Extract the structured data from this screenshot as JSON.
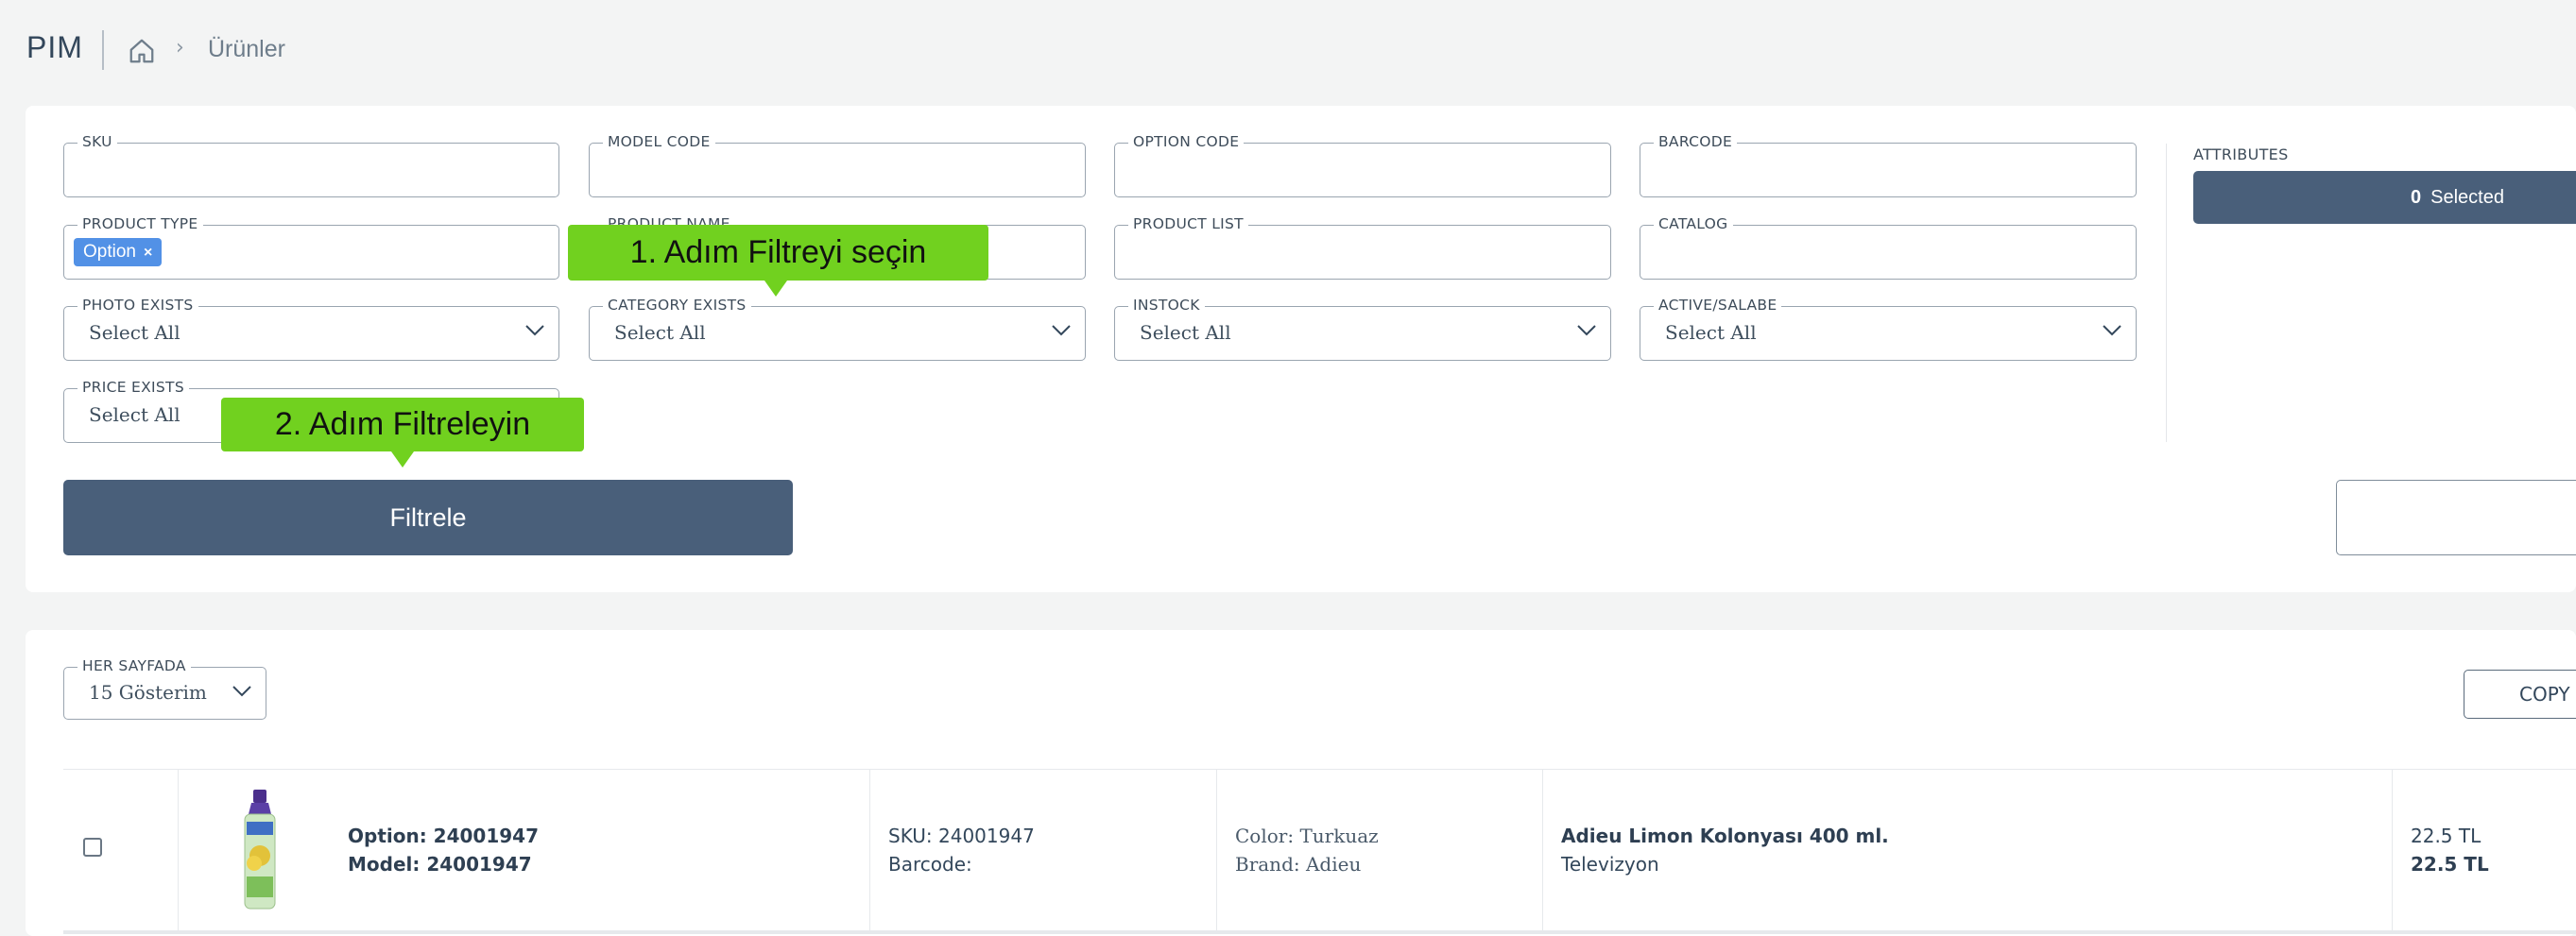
{
  "header": {
    "brand": "PIM",
    "breadcrumb": "Ürünler"
  },
  "filters": {
    "sku": {
      "label": "SKU",
      "value": ""
    },
    "model_code": {
      "label": "MODEL CODE",
      "value": ""
    },
    "option_code": {
      "label": "OPTION CODE",
      "value": ""
    },
    "barcode": {
      "label": "BARCODE",
      "value": ""
    },
    "product_type": {
      "label": "PRODUCT TYPE",
      "tag": "Option",
      "tag_remove": "×"
    },
    "product_name": {
      "label": "PRODUCT NAME",
      "value": ""
    },
    "product_list": {
      "label": "PRODUCT LIST",
      "value": ""
    },
    "catalog": {
      "label": "CATALOG",
      "value": ""
    },
    "photo_exists": {
      "label": "PHOTO EXISTS",
      "value": "Select All"
    },
    "category_exists": {
      "label": "CATEGORY EXISTS",
      "value": "Select All"
    },
    "instock": {
      "label": "INSTOCK",
      "value": "Select All"
    },
    "active_salable": {
      "label": "ACTIVE/SALABE",
      "value": "Select All"
    },
    "price_exists": {
      "label": "PRICE EXISTS",
      "value": "Select All"
    },
    "filter_button": "Filtrele"
  },
  "attributes": {
    "label": "ATTRIBUTES",
    "count": "0",
    "selected_text": "Selected"
  },
  "tooltips": {
    "step1": "1. Adım Filtreyi seçin",
    "step2": "2. Adım Filtreleyin"
  },
  "list": {
    "per_page_label": "HER SAYFADA",
    "per_page_value": "15 Gösterim",
    "copy_button": "COPY",
    "rows": [
      {
        "option": "Option: 24001947",
        "model": "Model: 24001947",
        "sku": "SKU: 24001947",
        "barcode": "Barcode:",
        "color": "Color: Turkuaz",
        "brand": "Brand: Adieu",
        "name": "Adieu Limon Kolonyası 400 ml.",
        "category": "Televizyon",
        "price1": "22.5 TL",
        "price2": "22.5 TL"
      }
    ]
  },
  "colors": {
    "primary": "#495f7a",
    "tag": "#5291e6",
    "tooltip": "#71d11f"
  }
}
